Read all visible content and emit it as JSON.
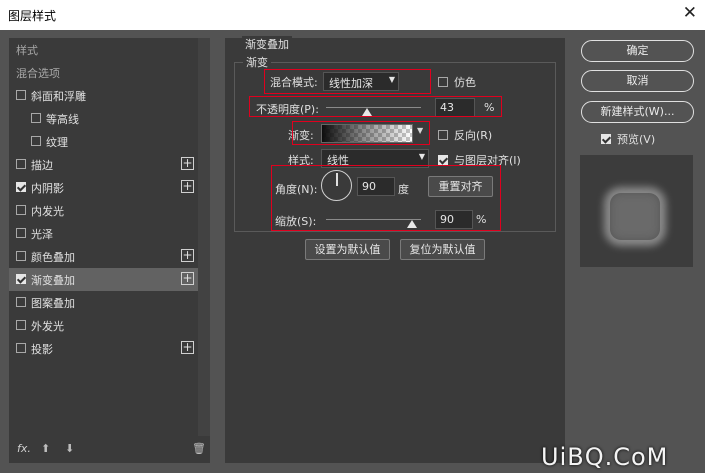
{
  "window": {
    "title": "图层样式",
    "close_icon": "✕"
  },
  "sidebar": {
    "items": [
      {
        "label": "样式",
        "checkbox": false,
        "checked": false,
        "plus": false,
        "indent": 0,
        "selected": false
      },
      {
        "label": "混合选项",
        "checkbox": false,
        "checked": false,
        "plus": false,
        "indent": 0,
        "selected": false
      },
      {
        "label": "斜面和浮雕",
        "checkbox": true,
        "checked": false,
        "plus": false,
        "indent": 0,
        "selected": false
      },
      {
        "label": "等高线",
        "checkbox": true,
        "checked": false,
        "plus": false,
        "indent": 1,
        "selected": false
      },
      {
        "label": "纹理",
        "checkbox": true,
        "checked": false,
        "plus": false,
        "indent": 1,
        "selected": false
      },
      {
        "label": "描边",
        "checkbox": true,
        "checked": false,
        "plus": true,
        "indent": 0,
        "selected": false
      },
      {
        "label": "内阴影",
        "checkbox": true,
        "checked": true,
        "plus": true,
        "indent": 0,
        "selected": false
      },
      {
        "label": "内发光",
        "checkbox": true,
        "checked": false,
        "plus": false,
        "indent": 0,
        "selected": false
      },
      {
        "label": "光泽",
        "checkbox": true,
        "checked": false,
        "plus": false,
        "indent": 0,
        "selected": false
      },
      {
        "label": "颜色叠加",
        "checkbox": true,
        "checked": false,
        "plus": true,
        "indent": 0,
        "selected": false
      },
      {
        "label": "渐变叠加",
        "checkbox": true,
        "checked": true,
        "plus": true,
        "indent": 0,
        "selected": true
      },
      {
        "label": "图案叠加",
        "checkbox": true,
        "checked": false,
        "plus": false,
        "indent": 0,
        "selected": false
      },
      {
        "label": "外发光",
        "checkbox": true,
        "checked": false,
        "plus": false,
        "indent": 0,
        "selected": false
      },
      {
        "label": "投影",
        "checkbox": true,
        "checked": false,
        "plus": true,
        "indent": 0,
        "selected": false
      }
    ],
    "footer": {
      "fx": "fx.",
      "up": "⬆",
      "down": "⬇",
      "trash": "🗑"
    }
  },
  "panel": {
    "title": "渐变叠加",
    "group": "渐变",
    "blend_mode_label": "混合模式:",
    "blend_mode_value": "线性加深",
    "dither_label": "仿色",
    "opacity_label": "不透明度(P):",
    "opacity_value": "43",
    "opacity_fraction": 0.43,
    "opacity_unit": "%",
    "gradient_label": "渐变:",
    "reverse_label": "反向(R)",
    "style_label": "样式:",
    "style_value": "线性",
    "align_label": "与图层对齐(I)",
    "angle_label": "角度(N):",
    "angle_value": "90",
    "angle_unit": "度",
    "reset_align_button": "重置对齐",
    "scale_label": "缩放(S):",
    "scale_value": "90",
    "scale_fraction": 0.9,
    "scale_unit": "%",
    "set_default_button": "设置为默认值",
    "reset_default_button": "复位为默认值"
  },
  "right": {
    "ok_button": "确定",
    "cancel_button": "取消",
    "new_style_button": "新建样式(W)...",
    "preview_label": "预览(V)"
  },
  "watermark": "UiBQ.CoM"
}
